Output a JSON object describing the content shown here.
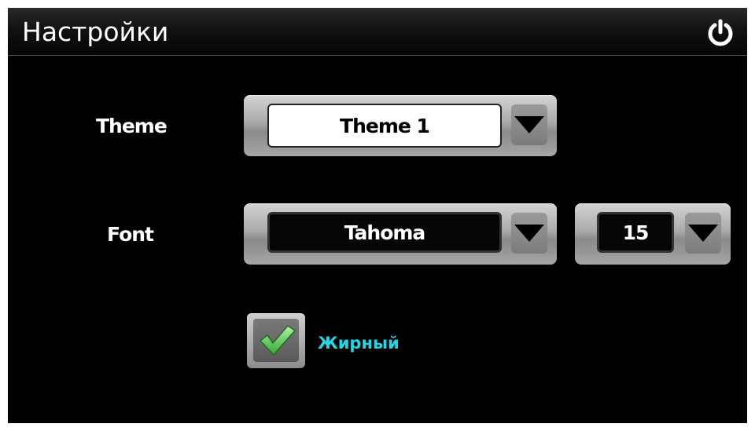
{
  "header": {
    "title": "Настройки",
    "power_icon": "power-icon"
  },
  "theme": {
    "label": "Theme",
    "value": "Theme 1"
  },
  "font": {
    "label": "Font",
    "value": "Tahoma",
    "size": "15"
  },
  "bold": {
    "label": "Жирный",
    "checked": true
  },
  "colors": {
    "background": "#000000",
    "accent_label": "#1fd8e8",
    "check": "#3ec93e"
  }
}
